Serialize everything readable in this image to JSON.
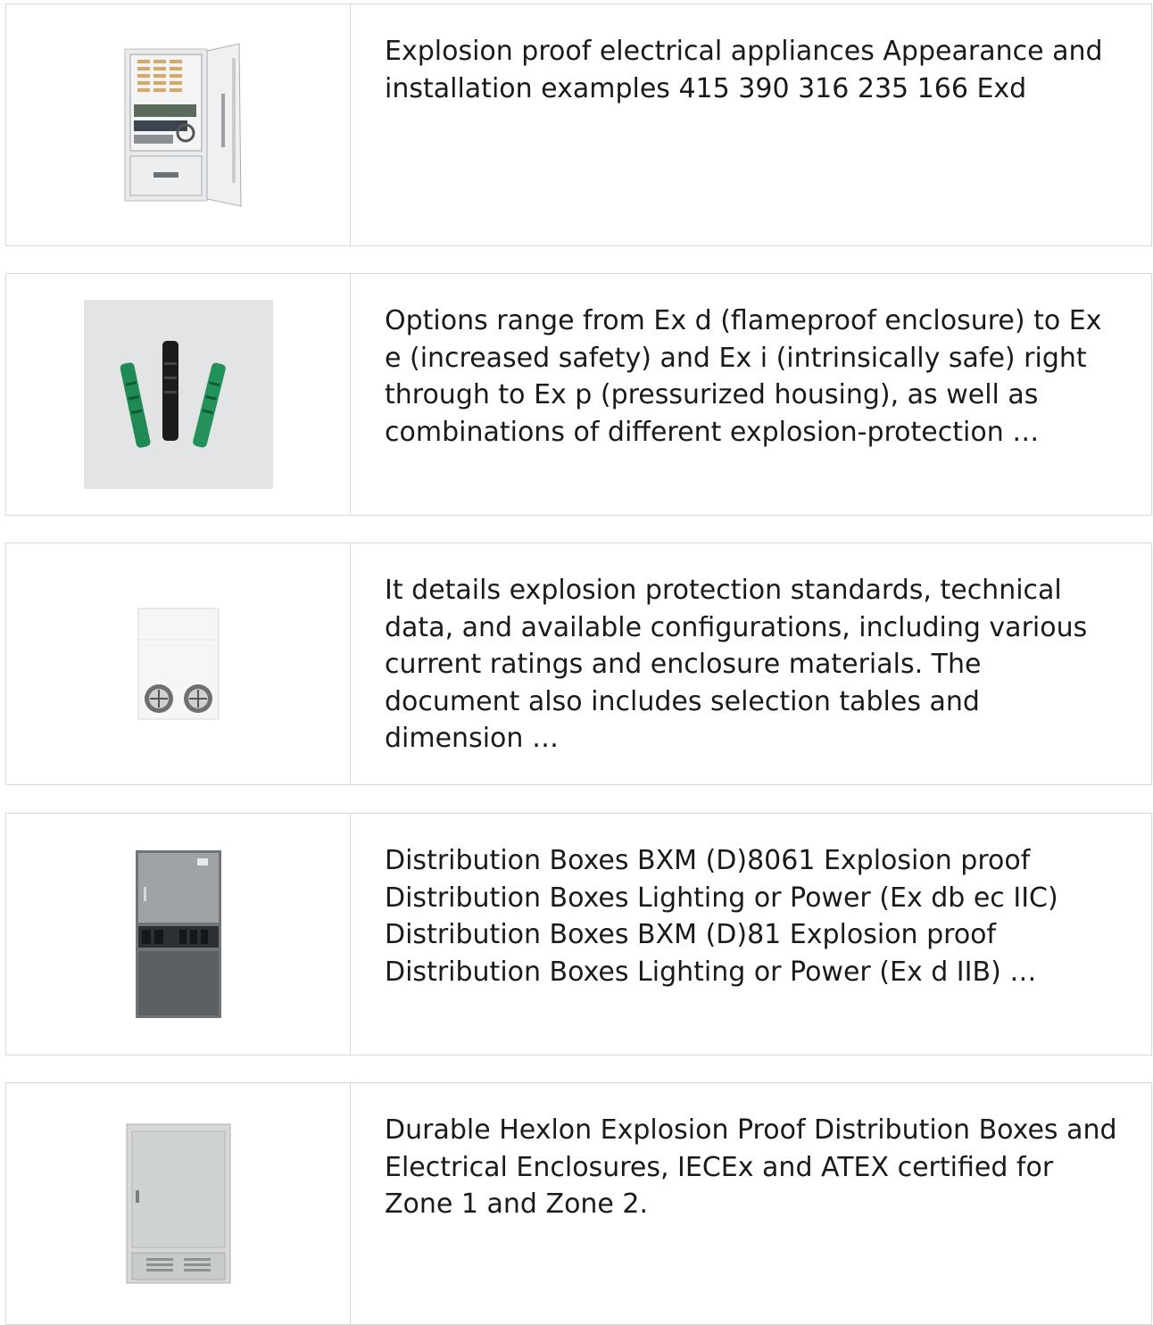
{
  "items": [
    {
      "image_icon": "outdoor-cabinet-open-door-image",
      "description": "Explosion proof electrical appliances Appearance and installation examples 415 390 316 235 166 Exd"
    },
    {
      "image_icon": "connector-boots-image",
      "description": "Options range from Ex d (flameproof enclosure) to Ex e (increased safety) and Ex i (intrinsically safe) right through to Ex p (pressurized housing), as well as combinations of different explosion-protection …"
    },
    {
      "image_icon": "enclosure-with-fans-image",
      "description": "It details explosion protection standards, technical data, and available configurations, including various current ratings and enclosure materials. The document also includes selection tables and dimension …"
    },
    {
      "image_icon": "distribution-cabinet-image",
      "description": "Distribution Boxes BXM (D)8061 Explosion proof Distribution Boxes Lighting or Power (Ex db ec IIC) Distribution Boxes BXM (D)81 Explosion proof Distribution Boxes Lighting or Power (Ex d IIB) …"
    },
    {
      "image_icon": "grey-floor-cabinet-image",
      "description": "Durable Hexlon Explosion Proof Distribution Boxes and Electrical Enclosures, IECEx and ATEX certified for Zone 1 and Zone 2."
    }
  ]
}
